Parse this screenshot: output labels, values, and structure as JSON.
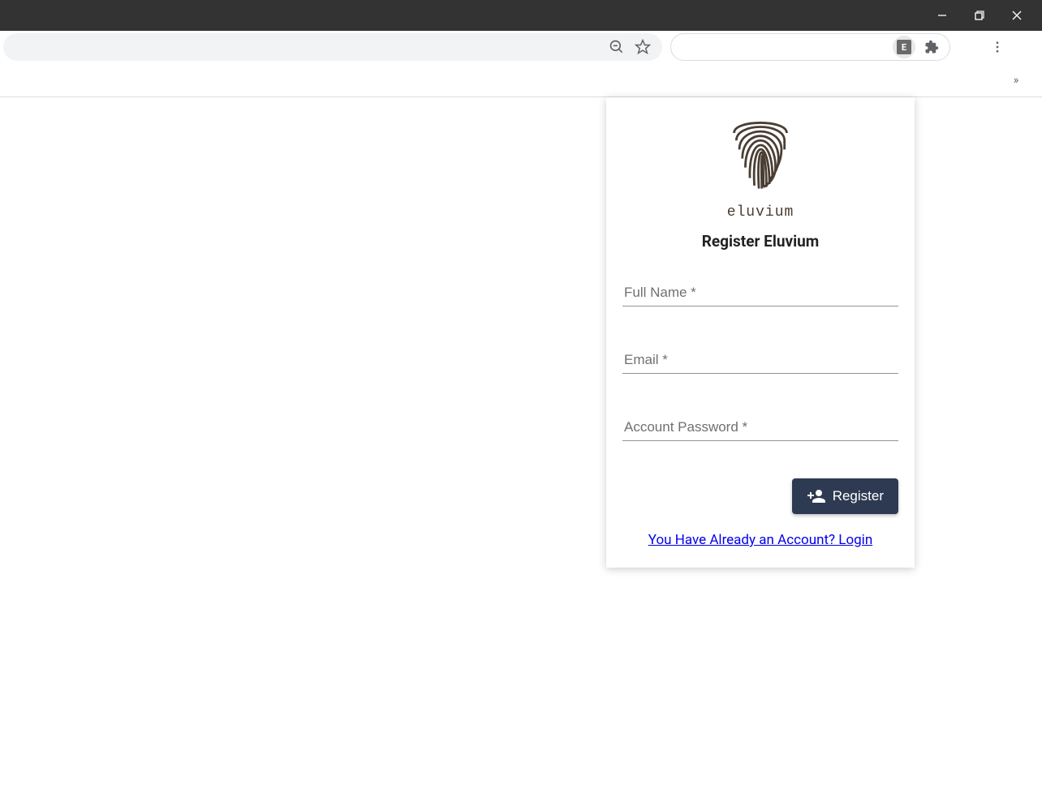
{
  "window": {
    "ext_badge_letter": "E"
  },
  "popup": {
    "brand": "eluvium",
    "title": "Register Eluvium",
    "fields": {
      "fullname_placeholder": "Full Name *",
      "email_placeholder": "Email *",
      "password_placeholder": "Account Password *",
      "fullname_value": "",
      "email_value": "",
      "password_value": ""
    },
    "register_label": "Register",
    "login_link_text": "You Have Already an Account? Login"
  }
}
